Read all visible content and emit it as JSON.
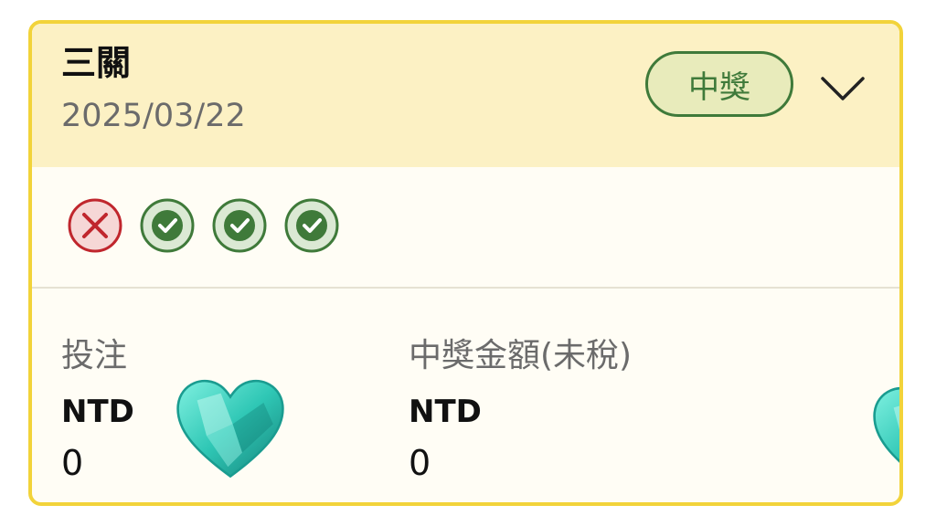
{
  "header": {
    "title": "三關",
    "date": "2025/03/22",
    "status_badge": "中獎"
  },
  "results": [
    {
      "status": "lose",
      "icon": "x-circle-icon"
    },
    {
      "status": "win",
      "icon": "check-circle-icon"
    },
    {
      "status": "win",
      "icon": "check-circle-icon"
    },
    {
      "status": "win",
      "icon": "check-circle-icon"
    }
  ],
  "stake": {
    "label": "投注",
    "currency": "NTD",
    "value": "0"
  },
  "payout": {
    "label": "中獎金額(未稅)",
    "currency": "NTD",
    "value": "0"
  },
  "colors": {
    "border": "#f2d33a",
    "header_bg": "#fcf1c4",
    "win_green": "#3f7a3a",
    "lose_red": "#c0262d",
    "badge_bg": "#e8ebbb"
  }
}
